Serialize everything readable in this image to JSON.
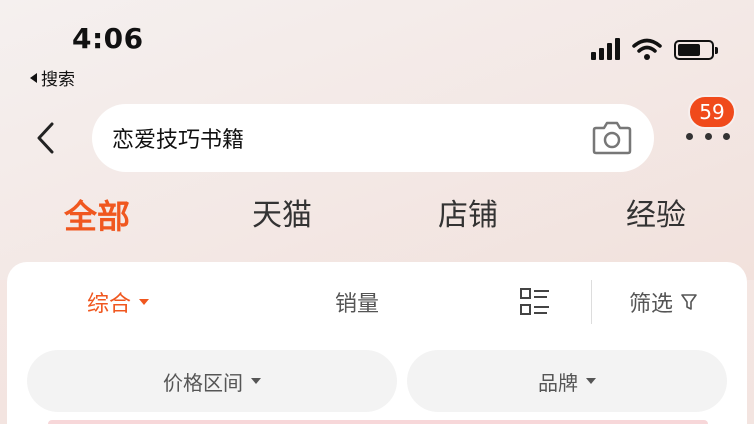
{
  "status_bar": {
    "time": "4:06",
    "back_app_label": "搜索"
  },
  "search": {
    "query": "恋爱技巧书籍",
    "camera_icon": "camera-icon"
  },
  "more": {
    "badge_count": "59"
  },
  "tabs": [
    {
      "label": "全部",
      "active": true
    },
    {
      "label": "天猫",
      "active": false
    },
    {
      "label": "店铺",
      "active": false
    },
    {
      "label": "经验",
      "active": false
    }
  ],
  "sort_bar": {
    "comprehensive": "综合",
    "sales": "销量",
    "filter": "筛选"
  },
  "filter_pills": {
    "price_range": "价格区间",
    "brand": "品牌"
  },
  "colors": {
    "accent": "#f0571f",
    "badge": "#f04a1b"
  }
}
